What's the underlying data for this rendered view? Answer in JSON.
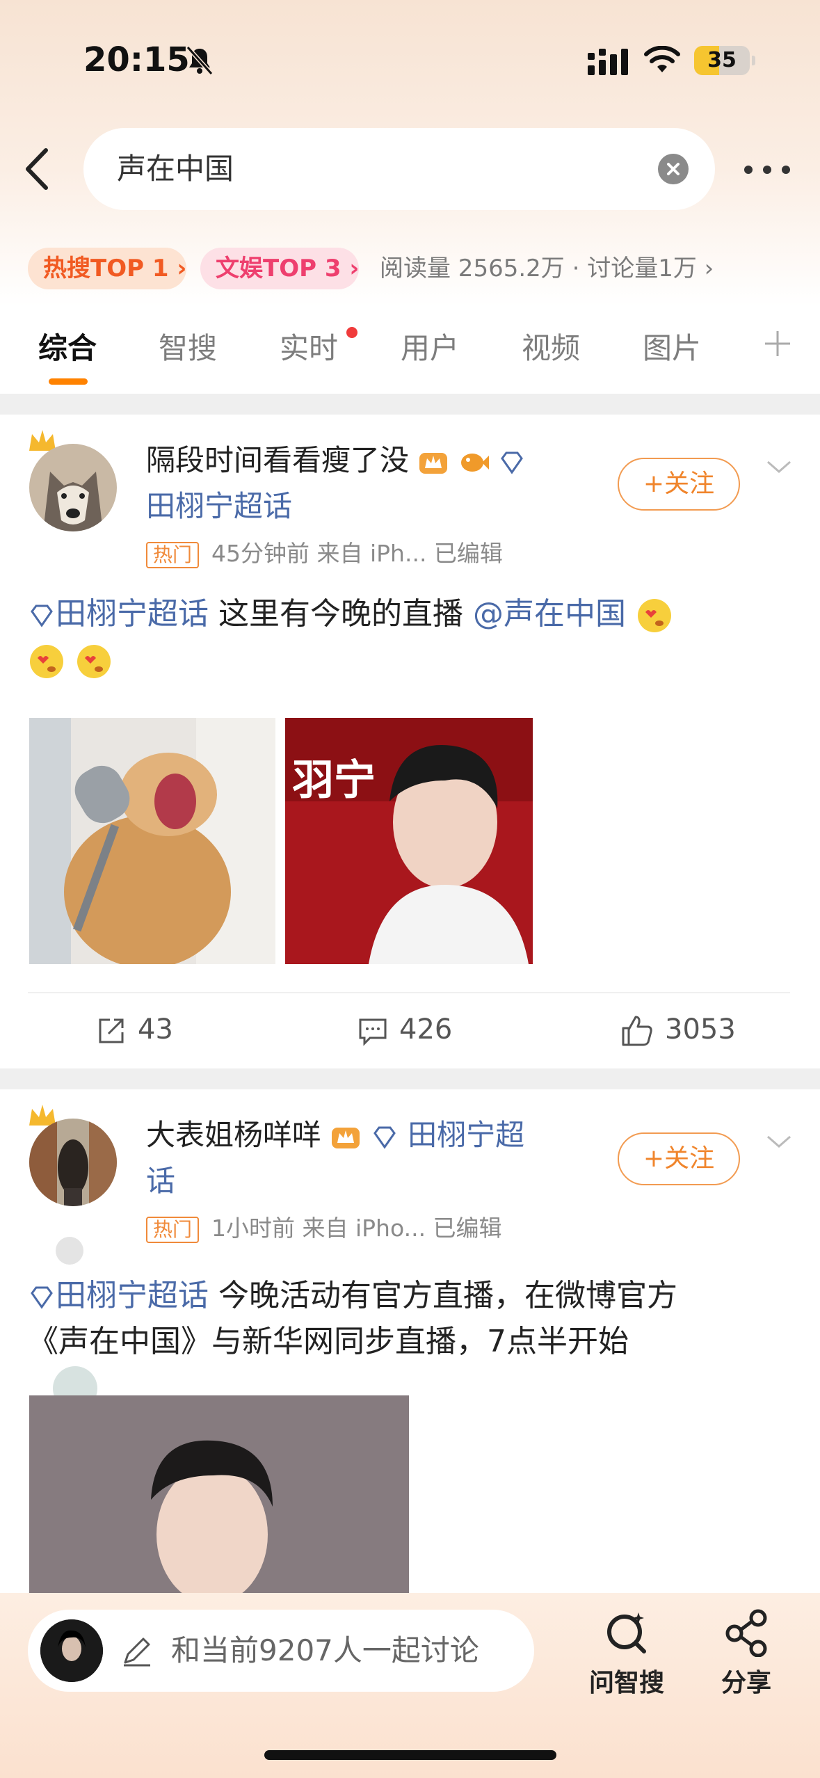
{
  "status_bar": {
    "time": "20:15",
    "battery": "35"
  },
  "search": {
    "query": "声在中国"
  },
  "hot": {
    "badge1": "热搜TOP 1",
    "badge2": "文娱TOP 3",
    "reads": "阅读量 2565.2万 · 讨论量1万"
  },
  "tabs": [
    {
      "label": "综合"
    },
    {
      "label": "智搜"
    },
    {
      "label": "实时"
    },
    {
      "label": "用户"
    },
    {
      "label": "视频"
    },
    {
      "label": "图片"
    }
  ],
  "posts": [
    {
      "user": "隔段时间看看瘦了没",
      "topic": "田栩宁超话",
      "hot_tag": "热门",
      "meta": "45分钟前  来自 iPh...  已编辑",
      "follow": "+关注",
      "text_topic": "田栩宁超话",
      "text_body": "这里有今晚的直播",
      "text_mention": "@声在中国",
      "reposts": "43",
      "comments": "426",
      "likes": "3053"
    },
    {
      "user": "大表姐杨咩咩",
      "topic_line1": "田栩宁超",
      "topic_line2": "话",
      "hot_tag": "热门",
      "meta": "1小时前  来自 iPho...  已编辑",
      "follow": "+关注",
      "text_topic": "田栩宁超话",
      "text_line1": "今晚活动有官方直播，在微博官方",
      "text_line2": "《声在中国》与新华网同步直播，7点半开始"
    }
  ],
  "bottom": {
    "discuss": "和当前9207人一起讨论",
    "ai_search": "问智搜",
    "share": "分享"
  },
  "colors": {
    "accent": "#ff8200",
    "link": "#4a6aa8",
    "hot": "#f15a22"
  }
}
